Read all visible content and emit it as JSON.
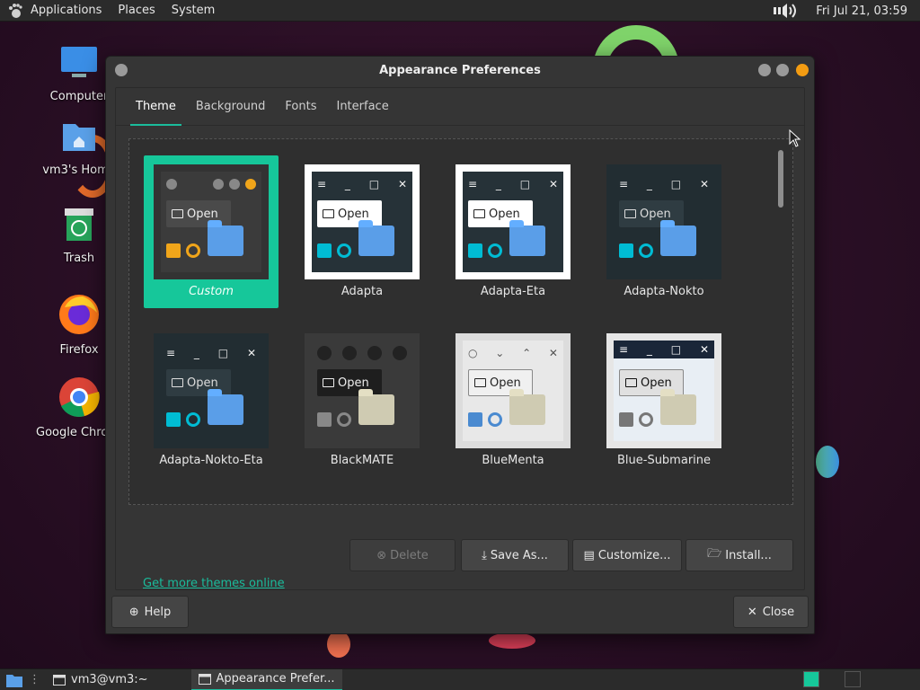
{
  "top_panel": {
    "menus": [
      "Applications",
      "Places",
      "System"
    ],
    "clock": "Fri Jul 21, 03:59"
  },
  "desktop": {
    "icons": [
      {
        "label": "Computer",
        "icon": "computer-icon"
      },
      {
        "label": "vm3's Home",
        "icon": "home-folder-icon"
      },
      {
        "label": "Trash",
        "icon": "trash-icon"
      },
      {
        "label": "Firefox",
        "icon": "firefox-icon"
      },
      {
        "label": "Google Chrome",
        "icon": "chrome-icon"
      }
    ]
  },
  "window": {
    "title": "Appearance Preferences",
    "tabs": [
      {
        "label": "Theme",
        "active": true
      },
      {
        "label": "Background",
        "active": false
      },
      {
        "label": "Fonts",
        "active": false
      },
      {
        "label": "Interface",
        "active": false
      }
    ],
    "themes": [
      {
        "name": "Custom",
        "selected": true,
        "style": "custom"
      },
      {
        "name": "Adapta",
        "selected": false,
        "style": "adapta"
      },
      {
        "name": "Adapta-Eta",
        "selected": false,
        "style": "adapta-eta"
      },
      {
        "name": "Adapta-Nokto",
        "selected": false,
        "style": "adapta-nokto"
      },
      {
        "name": "Adapta-Nokto-Eta",
        "selected": false,
        "style": "adapta-nokto-eta"
      },
      {
        "name": "BlackMATE",
        "selected": false,
        "style": "blackmate"
      },
      {
        "name": "BlueMenta",
        "selected": false,
        "style": "bluementa"
      },
      {
        "name": "Blue-Submarine",
        "selected": false,
        "style": "blue-submarine"
      }
    ],
    "thumb_open_label": "Open",
    "actions": {
      "delete": "Delete",
      "save_as": "Save As...",
      "customize": "Customize...",
      "install": "Install..."
    },
    "link": "Get more themes online",
    "help": "Help",
    "close": "Close"
  },
  "taskbar": {
    "tasks": [
      {
        "label": "vm3@vm3:~",
        "active": false
      },
      {
        "label": "Appearance Prefer...",
        "active": true
      }
    ]
  },
  "colors": {
    "accent": "#16c79a",
    "window_bg": "#353535",
    "panel_bg": "#2b2b2b"
  }
}
